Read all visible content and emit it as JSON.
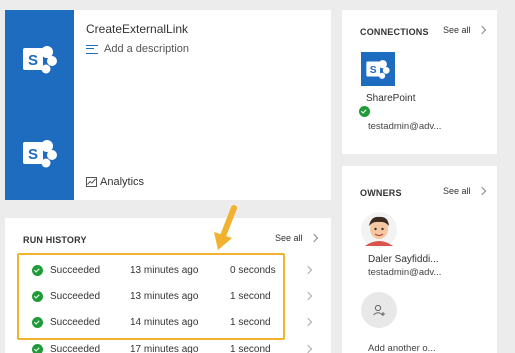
{
  "flow": {
    "name": "CreateExternalLink",
    "description_placeholder": "Add a description",
    "analytics_label": "Analytics"
  },
  "run_history": {
    "title": "RUN HISTORY",
    "see_all": "See all",
    "rows": [
      {
        "status": "Succeeded",
        "started": "13 minutes ago",
        "duration": "0 seconds"
      },
      {
        "status": "Succeeded",
        "started": "13 minutes ago",
        "duration": "1 second"
      },
      {
        "status": "Succeeded",
        "started": "14 minutes ago",
        "duration": "1 second"
      },
      {
        "status": "Succeeded",
        "started": "17 minutes ago",
        "duration": "1 second"
      }
    ]
  },
  "connections": {
    "title": "CONNECTIONS",
    "see_all": "See all",
    "items": [
      {
        "name": "SharePoint",
        "account": "testadmin@adv..."
      }
    ]
  },
  "owners": {
    "title": "OWNERS",
    "see_all": "See all",
    "items": [
      {
        "name": "Daler Sayfiddi...",
        "account": "testadmin@adv..."
      }
    ],
    "add_label": "Add another o..."
  },
  "colors": {
    "sharepoint_blue": "#1e6cbf",
    "success_green": "#1f9b3a",
    "callout_orange": "#f2b230"
  }
}
